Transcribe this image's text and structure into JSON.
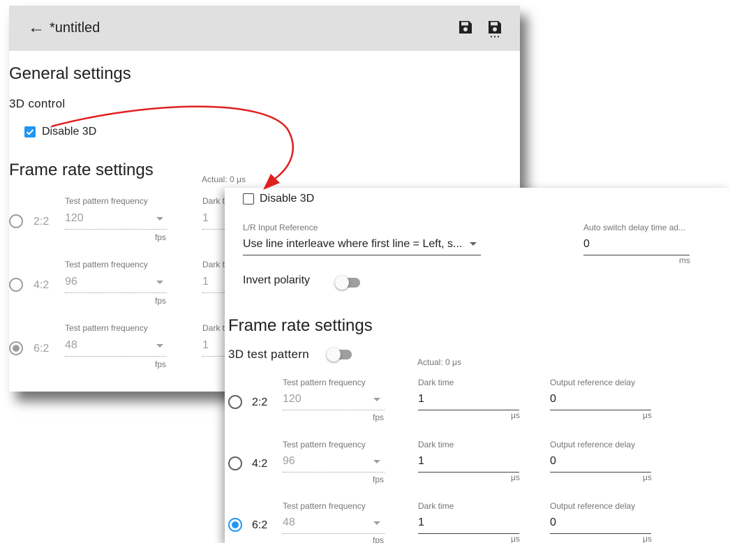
{
  "header": {
    "back_icon": "arrow-left-icon",
    "title": "*untitled",
    "save_icon": "floppy-disk-icon",
    "save_as_icon": "floppy-disk-more-icon"
  },
  "colors": {
    "appbar": "#e0e0e0",
    "accent": "#2196f3",
    "annotation_arrow": "#e02020"
  },
  "back": {
    "general_title": "General settings",
    "control_title": "3D control",
    "disable3d": {
      "label": "Disable 3D",
      "checked": true
    },
    "frame_title": "Frame rate settings",
    "actual": "Actual: 0 μs",
    "rows": [
      {
        "mode": "2:2",
        "freq_label": "Test pattern frequency",
        "freq": "120",
        "unit": "fps",
        "dark_label": "Dark t",
        "dark": "1",
        "selected": false
      },
      {
        "mode": "4:2",
        "freq_label": "Test pattern frequency",
        "freq": "96",
        "unit": "fps",
        "dark_label": "Dark t",
        "dark": "1",
        "selected": false
      },
      {
        "mode": "6:2",
        "freq_label": "Test pattern frequency",
        "freq": "48",
        "unit": "fps",
        "dark_label": "Dark t",
        "dark": "1",
        "selected": true
      }
    ]
  },
  "front": {
    "disable3d": {
      "label": "Disable 3D",
      "checked": false
    },
    "lr": {
      "label": "L/R Input Reference",
      "value": "Use line interleave where first line = Left, s..."
    },
    "auto": {
      "label": "Auto switch delay time ad...",
      "value": "0",
      "unit": "ms"
    },
    "invert": {
      "label": "Invert polarity",
      "on": false
    },
    "frame_title": "Frame rate settings",
    "test_pattern": {
      "label": "3D test pattern",
      "on": false
    },
    "actual": "Actual: 0 μs",
    "rows": [
      {
        "mode": "2:2",
        "freq_label": "Test pattern frequency",
        "freq": "120",
        "freq_unit": "fps",
        "dark_label": "Dark time",
        "dark": "1",
        "dark_unit": "μs",
        "out_label": "Output reference delay",
        "out": "0",
        "out_unit": "μs",
        "selected": false
      },
      {
        "mode": "4:2",
        "freq_label": "Test pattern frequency",
        "freq": "96",
        "freq_unit": "fps",
        "dark_label": "Dark time",
        "dark": "1",
        "dark_unit": "μs",
        "out_label": "Output reference delay",
        "out": "0",
        "out_unit": "μs",
        "selected": false
      },
      {
        "mode": "6:2",
        "freq_label": "Test pattern frequency",
        "freq": "48",
        "freq_unit": "fps",
        "dark_label": "Dark time",
        "dark": "1",
        "dark_unit": "μs",
        "out_label": "Output reference delay",
        "out": "0",
        "out_unit": "μs",
        "selected": true
      }
    ]
  }
}
